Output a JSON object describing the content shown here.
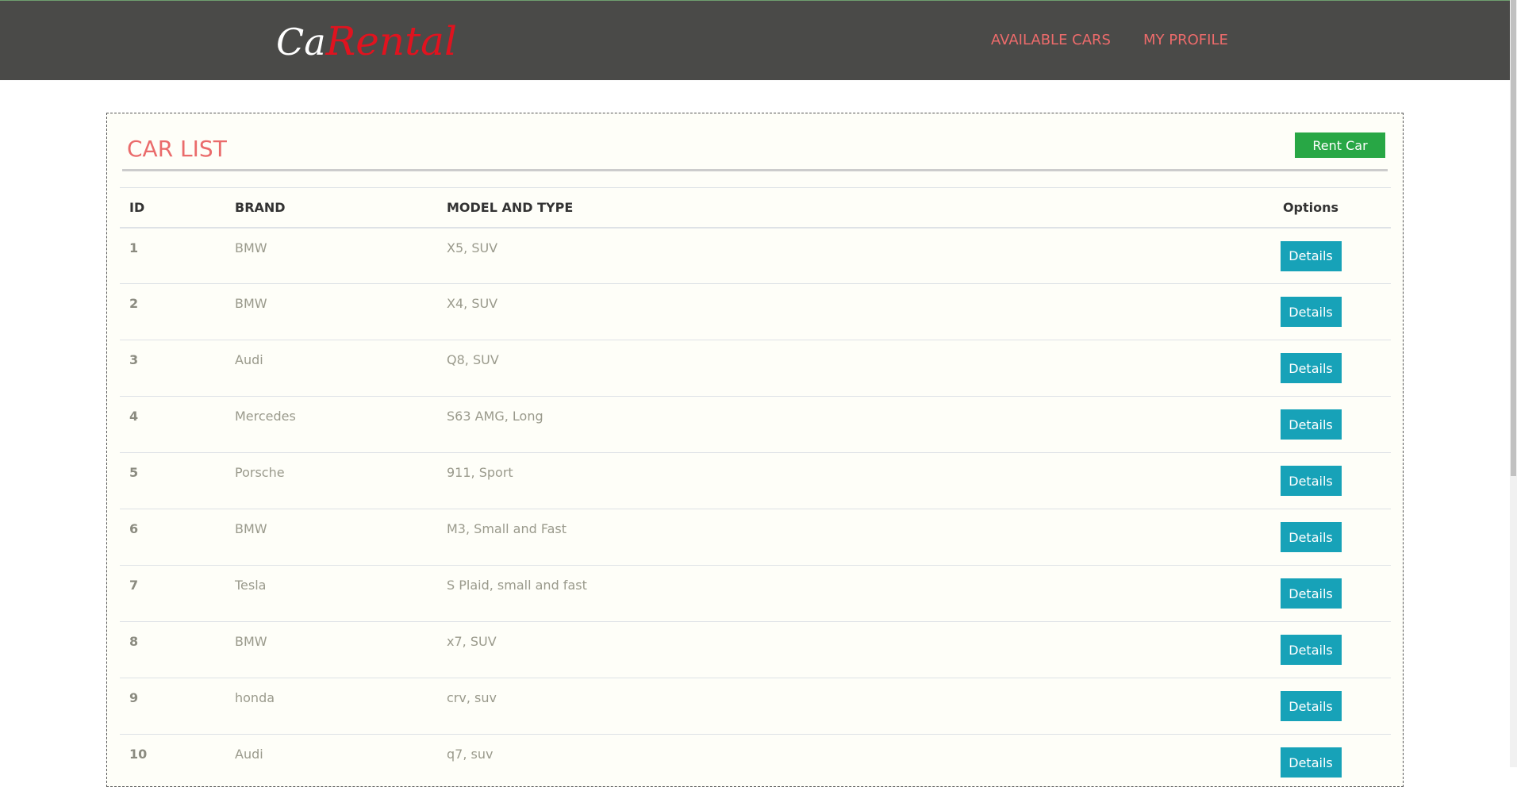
{
  "header": {
    "logo_part1": "Ca",
    "logo_part2": "Rental",
    "nav": {
      "available_cars": "AVAILABLE CARS",
      "my_profile": "MY PROFILE"
    }
  },
  "panel": {
    "title": "CAR LIST",
    "rent_button": "Rent Car"
  },
  "table": {
    "headers": {
      "id": "ID",
      "brand": "BRAND",
      "model": "MODEL AND TYPE",
      "options": "Options"
    },
    "details_label": "Details",
    "rows": [
      {
        "id": "1",
        "brand": "BMW",
        "model": "X5, SUV"
      },
      {
        "id": "2",
        "brand": "BMW",
        "model": "X4, SUV"
      },
      {
        "id": "3",
        "brand": "Audi",
        "model": "Q8, SUV"
      },
      {
        "id": "4",
        "brand": "Mercedes",
        "model": "S63 AMG, Long"
      },
      {
        "id": "5",
        "brand": "Porsche",
        "model": "911, Sport"
      },
      {
        "id": "6",
        "brand": "BMW",
        "model": "M3, Small and Fast"
      },
      {
        "id": "7",
        "brand": "Tesla",
        "model": "S Plaid, small and fast"
      },
      {
        "id": "8",
        "brand": "BMW",
        "model": "x7, SUV"
      },
      {
        "id": "9",
        "brand": "honda",
        "model": "crv, suv"
      },
      {
        "id": "10",
        "brand": "Audi",
        "model": "q7, suv"
      }
    ]
  },
  "colors": {
    "navbar": "#4a4a48",
    "accent": "#ec6b6b",
    "logo_red": "#e0131f",
    "rent_button": "#28a745",
    "details_button": "#17a2b8"
  }
}
